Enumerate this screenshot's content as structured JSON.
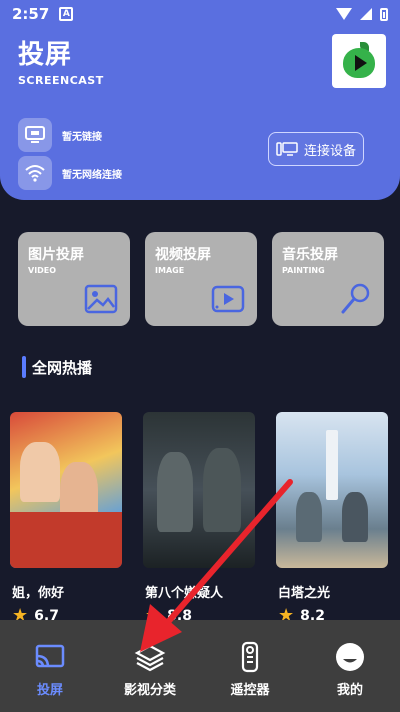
{
  "status_bar": {
    "time": "2:57",
    "badge": "A"
  },
  "header": {
    "title": "投屏",
    "subtitle": "SCREENCAST",
    "link_status": "暂无链接",
    "network_status": "暂无网络连接",
    "connect_button": "连接设备"
  },
  "features": [
    {
      "title": "图片投屏",
      "subtitle": "VIDEO",
      "icon": "image-icon"
    },
    {
      "title": "视频投屏",
      "subtitle": "IMAGE",
      "icon": "video-icon"
    },
    {
      "title": "音乐投屏",
      "subtitle": "PAINTING",
      "icon": "microphone-icon"
    }
  ],
  "hot_section": {
    "title": "全网热播"
  },
  "movies": [
    {
      "name": "姐，你好",
      "rating": "6.7"
    },
    {
      "name": "第八个嫌疑人",
      "rating": "8.8"
    },
    {
      "name": "白塔之光",
      "rating": "8.2"
    }
  ],
  "bottom_nav": [
    {
      "label": "投屏",
      "icon": "cast-icon",
      "active": true
    },
    {
      "label": "影视分类",
      "icon": "layers-icon",
      "active": false
    },
    {
      "label": "遥控器",
      "icon": "remote-icon",
      "active": false
    },
    {
      "label": "我的",
      "icon": "profile-icon",
      "active": false
    }
  ],
  "colors": {
    "accent": "#5a6fe0",
    "active_nav": "#6b8cff",
    "arrow": "#e8242c",
    "star": "#f5b323"
  }
}
